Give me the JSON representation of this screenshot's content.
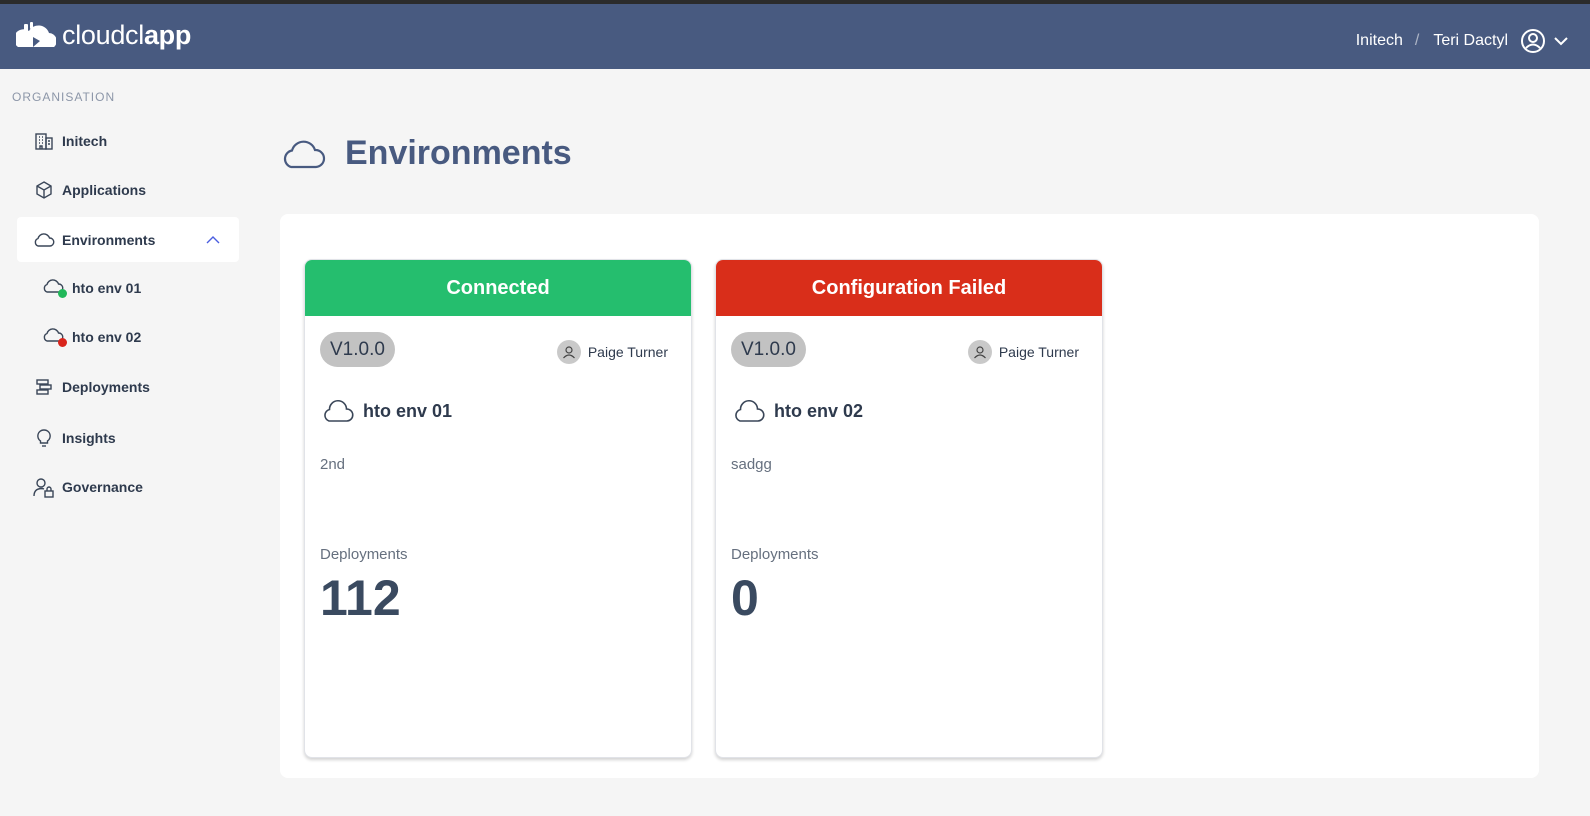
{
  "app": {
    "logo_text_light": "cloudcl",
    "logo_text_bold": "app"
  },
  "header": {
    "org": "Initech",
    "separator": "/",
    "user": "Teri Dactyl"
  },
  "sidebar": {
    "section_label": "ORGANISATION",
    "items": [
      {
        "label": "Initech",
        "icon": "building-icon"
      },
      {
        "label": "Applications",
        "icon": "box-icon"
      },
      {
        "label": "Environments",
        "icon": "cloud-icon",
        "expanded": true
      },
      {
        "label": "Deployments",
        "icon": "deployments-icon"
      },
      {
        "label": "Insights",
        "icon": "lightbulb-icon"
      },
      {
        "label": "Governance",
        "icon": "user-lock-icon"
      }
    ],
    "sub_items": [
      {
        "label": "hto env 01",
        "status_color": "#22b85a"
      },
      {
        "label": "hto env 02",
        "status_color": "#d9251c"
      }
    ]
  },
  "page": {
    "title": "Environments"
  },
  "cards": [
    {
      "status": "Connected",
      "status_color": "#25be6e",
      "version": "V1.0.0",
      "owner": "Paige Turner",
      "name": "hto env 01",
      "description": "2nd",
      "deployments_label": "Deployments",
      "deployments_count": "112"
    },
    {
      "status": "Configuration Failed",
      "status_color": "#d92e1a",
      "version": "V1.0.0",
      "owner": "Paige Turner",
      "name": "hto env 02",
      "description": "sadgg",
      "deployments_label": "Deployments",
      "deployments_count": "0"
    }
  ]
}
